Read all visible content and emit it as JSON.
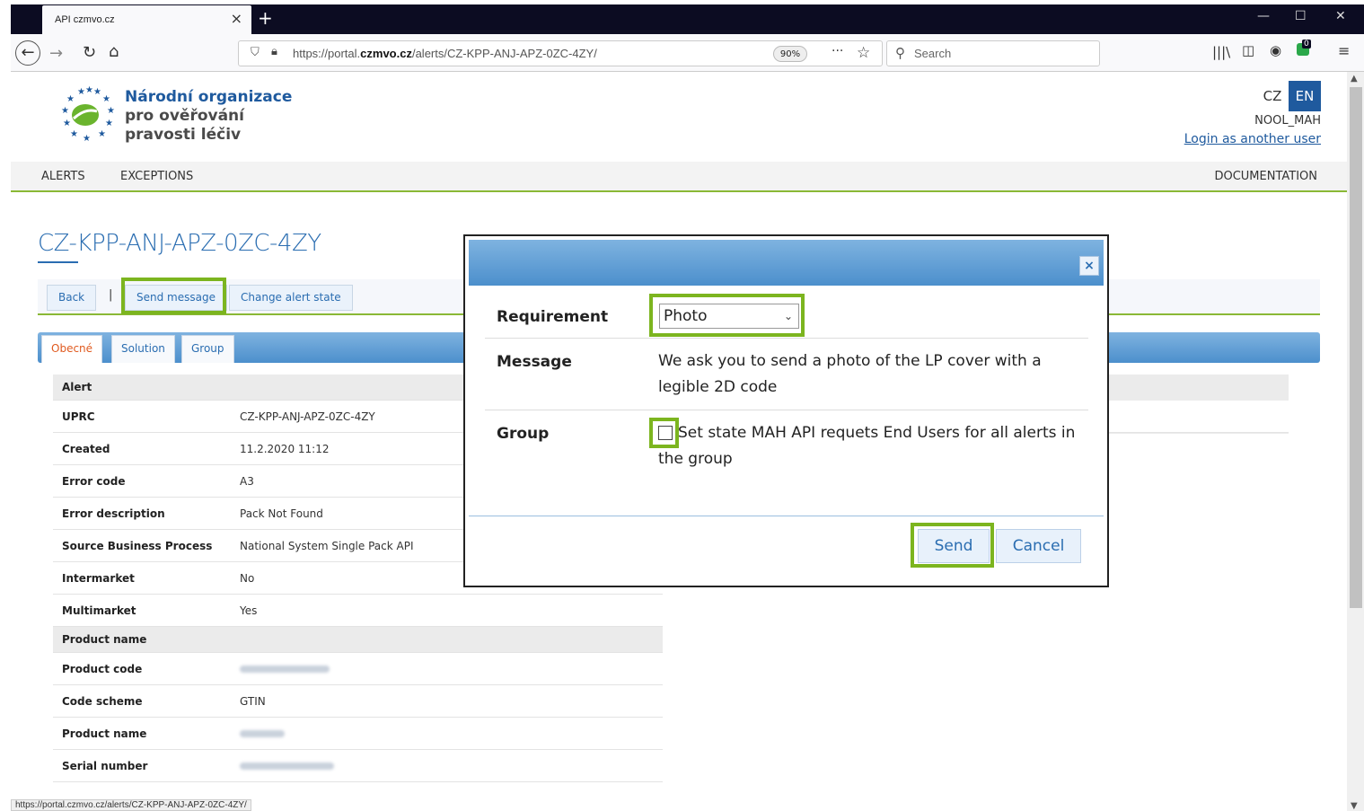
{
  "browser": {
    "tab_title": "API czmvo.cz",
    "url_prefix": "https://portal.",
    "url_domain": "czmvo.cz",
    "url_path": "/alerts/CZ-KPP-ANJ-APZ-0ZC-4ZY/",
    "zoom": "90%",
    "search_placeholder": "Search",
    "status_url": "https://portal.czmvo.cz/alerts/CZ-KPP-ANJ-APZ-0ZC-4ZY/",
    "extension_badge": "0"
  },
  "header": {
    "org_line1": "Národní organizace",
    "org_line2": "pro ověřování",
    "org_line3": "pravosti léčiv",
    "lang_cz": "CZ",
    "lang_en": "EN",
    "username": "NOOL_MAH",
    "login_link": "Login as another user"
  },
  "nav": {
    "alerts": "ALERTS",
    "exceptions": "EXCEPTIONS",
    "documentation": "DOCUMENTATION"
  },
  "alert": {
    "title": "CZ-KPP-ANJ-APZ-0ZC-4ZY",
    "actions": {
      "back": "Back",
      "separator": "|",
      "send_message": "Send message",
      "change_state": "Change alert state"
    },
    "tabs": [
      "Obecné",
      "Solution",
      "Group"
    ],
    "section_alert": "Alert",
    "section_product": "Product name",
    "rows": [
      {
        "key": "UPRC",
        "value": "CZ-KPP-ANJ-APZ-0ZC-4ZY"
      },
      {
        "key": "Created",
        "value": "11.2.2020 11:12"
      },
      {
        "key": "Error code",
        "value": "A3"
      },
      {
        "key": "Error description",
        "value": "Pack Not Found"
      },
      {
        "key": "Source Business Process",
        "value": "National System Single Pack API"
      },
      {
        "key": "Intermarket",
        "value": "No"
      },
      {
        "key": "Multimarket",
        "value": "Yes"
      }
    ],
    "product_rows": [
      {
        "key": "Product code",
        "value": ""
      },
      {
        "key": "Code scheme",
        "value": "GTIN"
      },
      {
        "key": "Product name",
        "value": ""
      },
      {
        "key": "Serial number",
        "value": ""
      }
    ]
  },
  "modal": {
    "requirement_label": "Requirement",
    "requirement_value": "Photo",
    "message_label": "Message",
    "message_text": "We ask you to send a photo of the LP cover with a legible 2D code",
    "group_label": "Group",
    "group_checkbox_text": "Set state MAH API requets End Users for all alerts in the group",
    "group_checked": false,
    "send": "Send",
    "cancel": "Cancel",
    "close_glyph": "×"
  },
  "colors": {
    "accent": "#1f5a9e",
    "highlight": "#7cb51f",
    "nav_underline": "#8ab835"
  }
}
